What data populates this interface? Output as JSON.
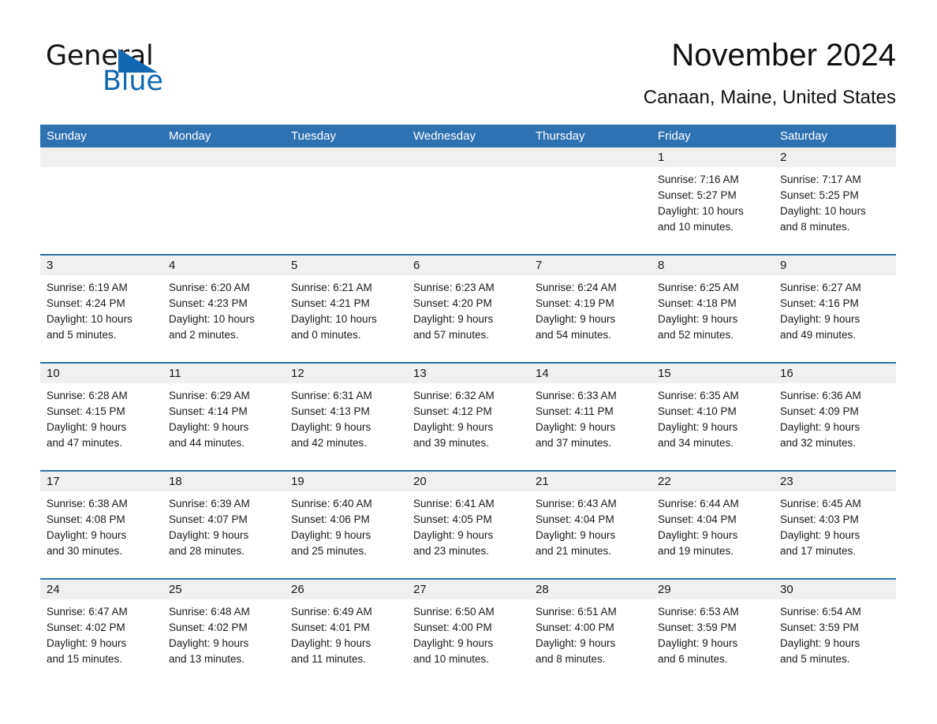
{
  "logo": {
    "word_one": "General",
    "word_two": "Blue",
    "triangle_color": "#1268b3",
    "text_color": "#141414"
  },
  "header": {
    "title": "November 2024",
    "subtitle": "Canaan, Maine, United States"
  },
  "theme": {
    "header_blue": "#2f72b2",
    "daynum_band": "#f0f0f0",
    "separator_blue": "#2f72b2",
    "text": "#1a1a1a"
  },
  "weekdays": [
    "Sunday",
    "Monday",
    "Tuesday",
    "Wednesday",
    "Thursday",
    "Friday",
    "Saturday"
  ],
  "weeks": [
    [
      {
        "day": "",
        "sunrise": "",
        "sunset": "",
        "daylight_1": "",
        "daylight_2": ""
      },
      {
        "day": "",
        "sunrise": "",
        "sunset": "",
        "daylight_1": "",
        "daylight_2": ""
      },
      {
        "day": "",
        "sunrise": "",
        "sunset": "",
        "daylight_1": "",
        "daylight_2": ""
      },
      {
        "day": "",
        "sunrise": "",
        "sunset": "",
        "daylight_1": "",
        "daylight_2": ""
      },
      {
        "day": "",
        "sunrise": "",
        "sunset": "",
        "daylight_1": "",
        "daylight_2": ""
      },
      {
        "day": "1",
        "sunrise": "Sunrise: 7:16 AM",
        "sunset": "Sunset: 5:27 PM",
        "daylight_1": "Daylight: 10 hours",
        "daylight_2": "and 10 minutes."
      },
      {
        "day": "2",
        "sunrise": "Sunrise: 7:17 AM",
        "sunset": "Sunset: 5:25 PM",
        "daylight_1": "Daylight: 10 hours",
        "daylight_2": "and 8 minutes."
      }
    ],
    [
      {
        "day": "3",
        "sunrise": "Sunrise: 6:19 AM",
        "sunset": "Sunset: 4:24 PM",
        "daylight_1": "Daylight: 10 hours",
        "daylight_2": "and 5 minutes."
      },
      {
        "day": "4",
        "sunrise": "Sunrise: 6:20 AM",
        "sunset": "Sunset: 4:23 PM",
        "daylight_1": "Daylight: 10 hours",
        "daylight_2": "and 2 minutes."
      },
      {
        "day": "5",
        "sunrise": "Sunrise: 6:21 AM",
        "sunset": "Sunset: 4:21 PM",
        "daylight_1": "Daylight: 10 hours",
        "daylight_2": "and 0 minutes."
      },
      {
        "day": "6",
        "sunrise": "Sunrise: 6:23 AM",
        "sunset": "Sunset: 4:20 PM",
        "daylight_1": "Daylight: 9 hours",
        "daylight_2": "and 57 minutes."
      },
      {
        "day": "7",
        "sunrise": "Sunrise: 6:24 AM",
        "sunset": "Sunset: 4:19 PM",
        "daylight_1": "Daylight: 9 hours",
        "daylight_2": "and 54 minutes."
      },
      {
        "day": "8",
        "sunrise": "Sunrise: 6:25 AM",
        "sunset": "Sunset: 4:18 PM",
        "daylight_1": "Daylight: 9 hours",
        "daylight_2": "and 52 minutes."
      },
      {
        "day": "9",
        "sunrise": "Sunrise: 6:27 AM",
        "sunset": "Sunset: 4:16 PM",
        "daylight_1": "Daylight: 9 hours",
        "daylight_2": "and 49 minutes."
      }
    ],
    [
      {
        "day": "10",
        "sunrise": "Sunrise: 6:28 AM",
        "sunset": "Sunset: 4:15 PM",
        "daylight_1": "Daylight: 9 hours",
        "daylight_2": "and 47 minutes."
      },
      {
        "day": "11",
        "sunrise": "Sunrise: 6:29 AM",
        "sunset": "Sunset: 4:14 PM",
        "daylight_1": "Daylight: 9 hours",
        "daylight_2": "and 44 minutes."
      },
      {
        "day": "12",
        "sunrise": "Sunrise: 6:31 AM",
        "sunset": "Sunset: 4:13 PM",
        "daylight_1": "Daylight: 9 hours",
        "daylight_2": "and 42 minutes."
      },
      {
        "day": "13",
        "sunrise": "Sunrise: 6:32 AM",
        "sunset": "Sunset: 4:12 PM",
        "daylight_1": "Daylight: 9 hours",
        "daylight_2": "and 39 minutes."
      },
      {
        "day": "14",
        "sunrise": "Sunrise: 6:33 AM",
        "sunset": "Sunset: 4:11 PM",
        "daylight_1": "Daylight: 9 hours",
        "daylight_2": "and 37 minutes."
      },
      {
        "day": "15",
        "sunrise": "Sunrise: 6:35 AM",
        "sunset": "Sunset: 4:10 PM",
        "daylight_1": "Daylight: 9 hours",
        "daylight_2": "and 34 minutes."
      },
      {
        "day": "16",
        "sunrise": "Sunrise: 6:36 AM",
        "sunset": "Sunset: 4:09 PM",
        "daylight_1": "Daylight: 9 hours",
        "daylight_2": "and 32 minutes."
      }
    ],
    [
      {
        "day": "17",
        "sunrise": "Sunrise: 6:38 AM",
        "sunset": "Sunset: 4:08 PM",
        "daylight_1": "Daylight: 9 hours",
        "daylight_2": "and 30 minutes."
      },
      {
        "day": "18",
        "sunrise": "Sunrise: 6:39 AM",
        "sunset": "Sunset: 4:07 PM",
        "daylight_1": "Daylight: 9 hours",
        "daylight_2": "and 28 minutes."
      },
      {
        "day": "19",
        "sunrise": "Sunrise: 6:40 AM",
        "sunset": "Sunset: 4:06 PM",
        "daylight_1": "Daylight: 9 hours",
        "daylight_2": "and 25 minutes."
      },
      {
        "day": "20",
        "sunrise": "Sunrise: 6:41 AM",
        "sunset": "Sunset: 4:05 PM",
        "daylight_1": "Daylight: 9 hours",
        "daylight_2": "and 23 minutes."
      },
      {
        "day": "21",
        "sunrise": "Sunrise: 6:43 AM",
        "sunset": "Sunset: 4:04 PM",
        "daylight_1": "Daylight: 9 hours",
        "daylight_2": "and 21 minutes."
      },
      {
        "day": "22",
        "sunrise": "Sunrise: 6:44 AM",
        "sunset": "Sunset: 4:04 PM",
        "daylight_1": "Daylight: 9 hours",
        "daylight_2": "and 19 minutes."
      },
      {
        "day": "23",
        "sunrise": "Sunrise: 6:45 AM",
        "sunset": "Sunset: 4:03 PM",
        "daylight_1": "Daylight: 9 hours",
        "daylight_2": "and 17 minutes."
      }
    ],
    [
      {
        "day": "24",
        "sunrise": "Sunrise: 6:47 AM",
        "sunset": "Sunset: 4:02 PM",
        "daylight_1": "Daylight: 9 hours",
        "daylight_2": "and 15 minutes."
      },
      {
        "day": "25",
        "sunrise": "Sunrise: 6:48 AM",
        "sunset": "Sunset: 4:02 PM",
        "daylight_1": "Daylight: 9 hours",
        "daylight_2": "and 13 minutes."
      },
      {
        "day": "26",
        "sunrise": "Sunrise: 6:49 AM",
        "sunset": "Sunset: 4:01 PM",
        "daylight_1": "Daylight: 9 hours",
        "daylight_2": "and 11 minutes."
      },
      {
        "day": "27",
        "sunrise": "Sunrise: 6:50 AM",
        "sunset": "Sunset: 4:00 PM",
        "daylight_1": "Daylight: 9 hours",
        "daylight_2": "and 10 minutes."
      },
      {
        "day": "28",
        "sunrise": "Sunrise: 6:51 AM",
        "sunset": "Sunset: 4:00 PM",
        "daylight_1": "Daylight: 9 hours",
        "daylight_2": "and 8 minutes."
      },
      {
        "day": "29",
        "sunrise": "Sunrise: 6:53 AM",
        "sunset": "Sunset: 3:59 PM",
        "daylight_1": "Daylight: 9 hours",
        "daylight_2": "and 6 minutes."
      },
      {
        "day": "30",
        "sunrise": "Sunrise: 6:54 AM",
        "sunset": "Sunset: 3:59 PM",
        "daylight_1": "Daylight: 9 hours",
        "daylight_2": "and 5 minutes."
      }
    ]
  ]
}
